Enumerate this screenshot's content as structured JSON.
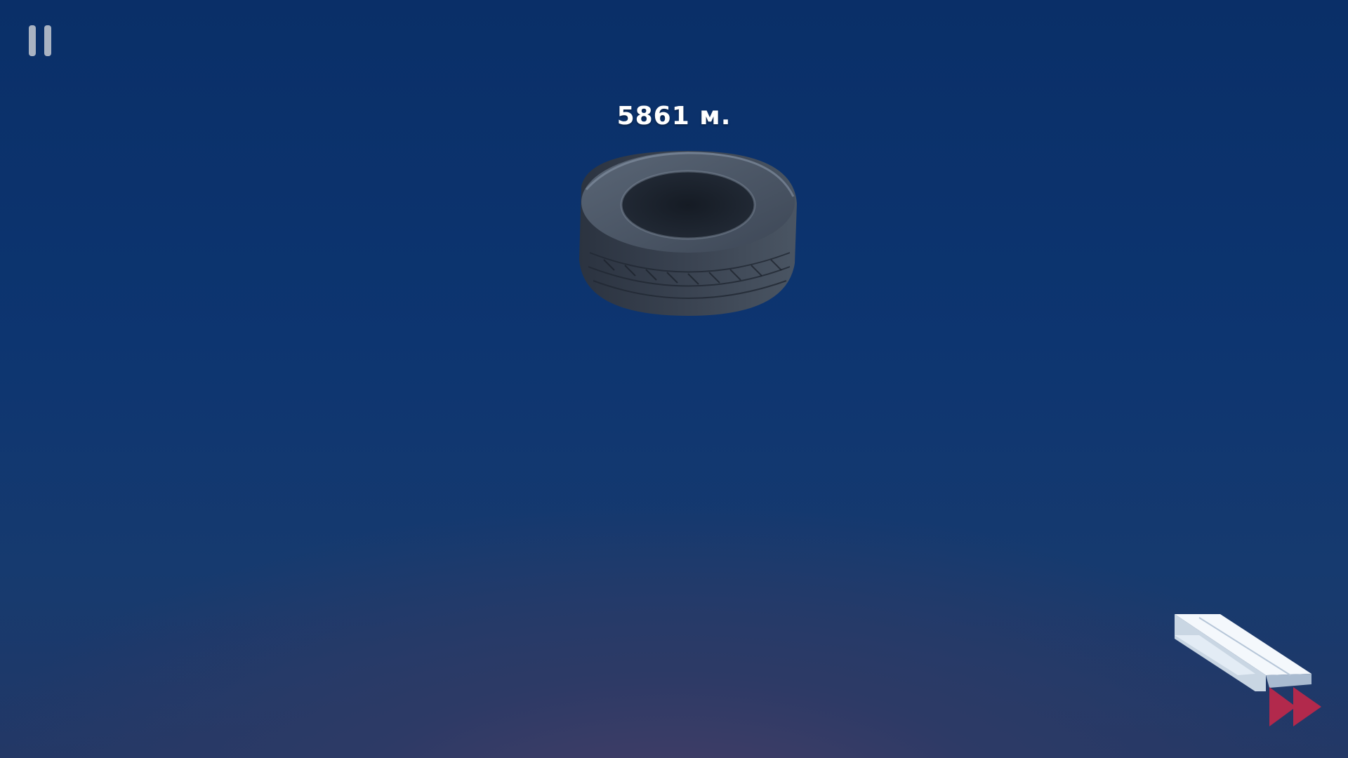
{
  "hud": {
    "distance_text": "5861 м.",
    "pause_icon": "pause-icon",
    "fast_forward_icon": "fast-forward-icon"
  },
  "scene": {
    "object": "tire",
    "background_top": "#0a2f68",
    "background_bottom": "#2d3a66"
  },
  "colors": {
    "fast_forward": "#b2294c",
    "pause": "#a9b3c2",
    "text": "#ffffff"
  }
}
